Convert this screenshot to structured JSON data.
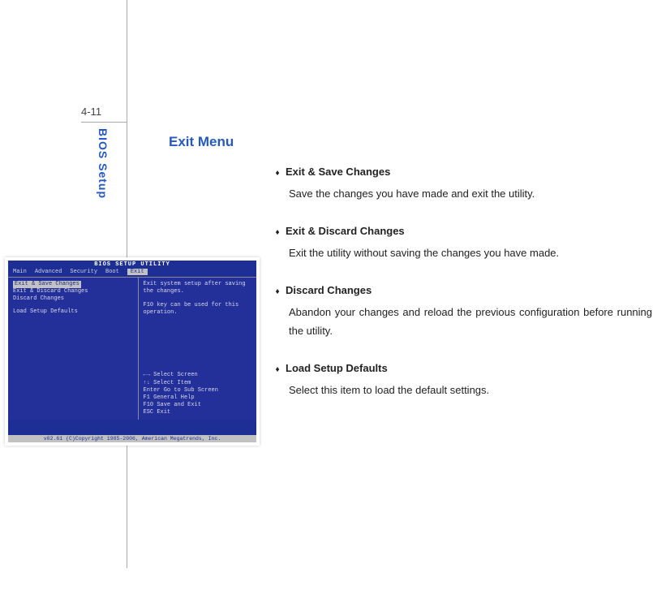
{
  "page_number": "4-11",
  "side_label": "BIOS Setup",
  "title": "Exit Menu",
  "items": [
    {
      "head": "Exit & Save Changes",
      "desc": "Save the changes you have made and exit the utility."
    },
    {
      "head": "Exit & Discard Changes",
      "desc": "Exit the utility without saving the changes you have made."
    },
    {
      "head": "Discard Changes",
      "desc": "Abandon your changes and reload the previous configuration before running the utility.",
      "justify": true
    },
    {
      "head": "Load Setup Defaults",
      "desc": "Select this item to load the default settings."
    }
  ],
  "bios": {
    "title": "BIOS SETUP UTILITY",
    "tabs": [
      "Main",
      "Advanced",
      "Security",
      "Boot",
      "Exit"
    ],
    "active_tab": "Exit",
    "menu": [
      "Exit & Save Changes",
      "Exit & Discard Changes",
      "Discard Changes",
      "",
      "Load Setup Defaults"
    ],
    "selected": "Exit & Save Changes",
    "help_top": "Exit system setup after saving the changes.\n\nF10 key can be used for this operation.",
    "keys": [
      "←→   Select Screen",
      "↑↓   Select Item",
      "Enter Go to Sub Screen",
      "F1   General Help",
      "F10  Save and Exit",
      "ESC  Exit"
    ],
    "footer": "v02.61 (C)Copyright 1985-2006, American Megatrends, Inc."
  }
}
